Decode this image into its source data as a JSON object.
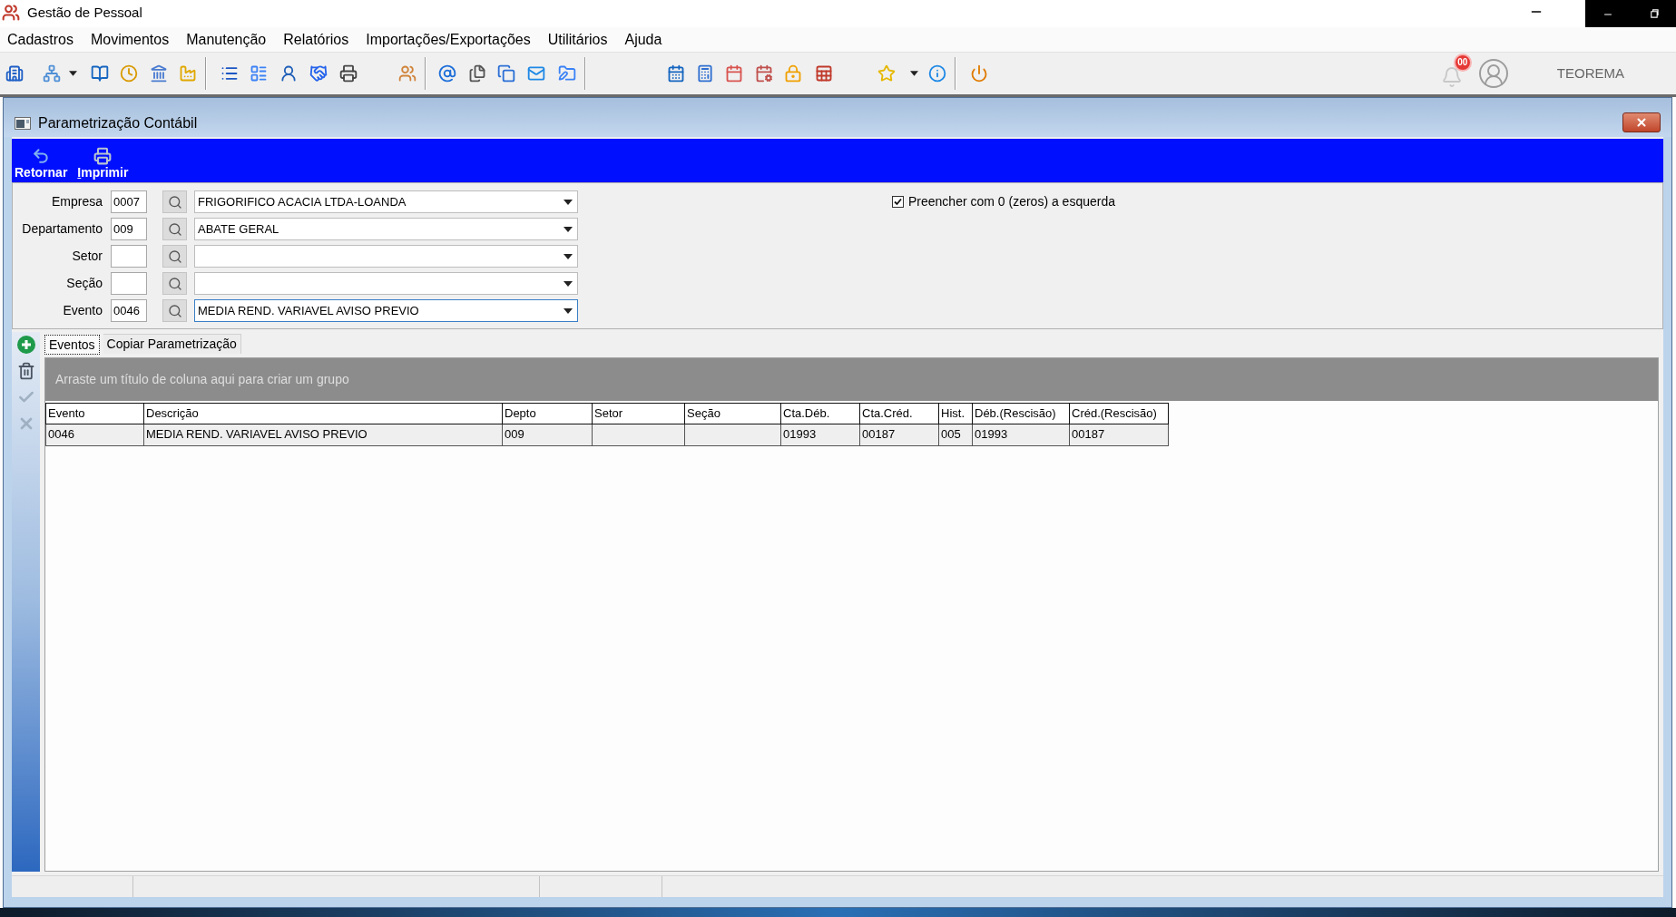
{
  "app": {
    "title": "Gestão de Pessoal",
    "notifications": "00",
    "user": "TEOREMA"
  },
  "menu": [
    "Cadastros",
    "Movimentos",
    "Manutenção",
    "Relatórios",
    "Importações/Exportações",
    "Utilitários",
    "Ajuda"
  ],
  "window": {
    "title": "Parametrização Contábil"
  },
  "actions": [
    {
      "label": "Retornar",
      "kind": "back",
      "mnemonic": false
    },
    {
      "label": "Imprimir",
      "kind": "print",
      "mnemonic": true
    }
  ],
  "form": {
    "fields": [
      {
        "label": "Empresa",
        "code": "0007",
        "value": "FRIGORIFICO ACACIA LTDA-LOANDA",
        "focused": false
      },
      {
        "label": "Departamento",
        "code": "009",
        "value": "ABATE GERAL",
        "focused": false
      },
      {
        "label": "Setor",
        "focused": false
      },
      {
        "label": "Seção",
        "focused": false
      },
      {
        "label": "Evento",
        "code": "0046",
        "value": "MEDIA REND. VARIAVEL AVISO PREVIO",
        "focused": true
      }
    ],
    "zero_fill": {
      "label": "Preencher com 0 (zeros) a esquerda",
      "checked": true
    }
  },
  "side_tools": [
    {
      "kind": "add",
      "disabled": false
    },
    {
      "kind": "delete",
      "disabled": false
    },
    {
      "kind": "confirm",
      "disabled": true
    },
    {
      "kind": "cancel",
      "disabled": true
    }
  ],
  "tabs": [
    {
      "label": "Eventos",
      "selected": true
    },
    {
      "label": "Copiar Parametrização",
      "selected": false
    }
  ],
  "grid": {
    "group_panel": "Arraste um título de coluna aqui para criar um grupo",
    "columns": [
      "Evento",
      "Descrição",
      "Depto",
      "Setor",
      "Seção",
      "Cta.Déb.",
      "Cta.Créd.",
      "Hist.",
      "Déb.(Rescisão)",
      "Créd.(Rescisão)"
    ],
    "rows": [
      {
        "selected": true,
        "cells": [
          "0046",
          "MEDIA REND. VARIAVEL AVISO PREVIO",
          "009",
          null,
          null,
          "01993",
          "00187",
          "005",
          "01993",
          "00187"
        ]
      }
    ]
  }
}
